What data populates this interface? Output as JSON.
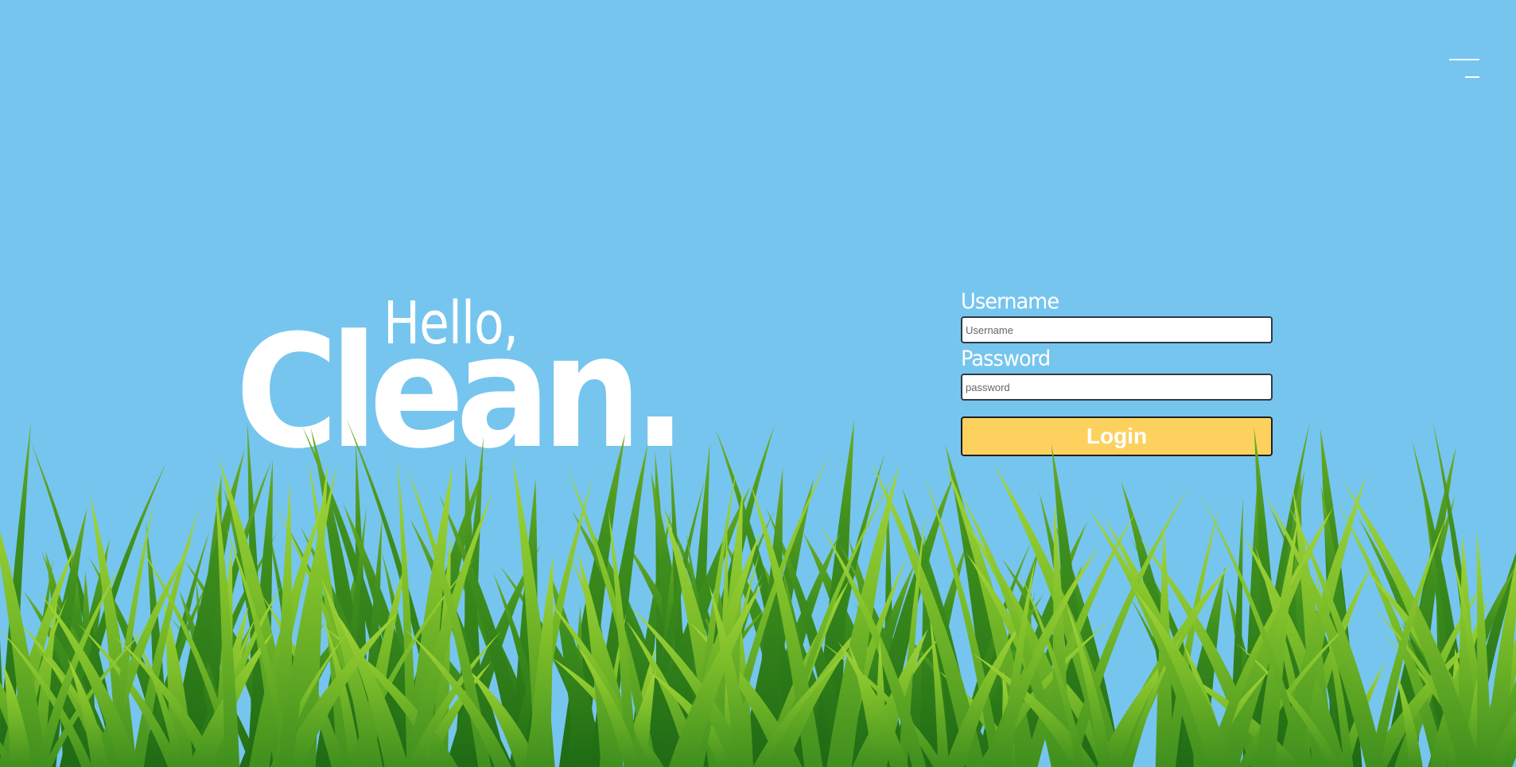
{
  "theme": {
    "sky_color": "#76c5ee",
    "accent_button": "#fdd15e",
    "grass_light": "#8dc63f",
    "grass_dark": "#2e7d1a"
  },
  "header": {
    "menu_icon": "hamburger-menu-icon"
  },
  "hero": {
    "greeting": "Hello,",
    "headline": "Clean."
  },
  "login": {
    "username_label": "Username",
    "username_placeholder": "Username",
    "username_value": "",
    "password_label": "Password",
    "password_placeholder": "password",
    "password_value": "",
    "submit_label": "Login"
  },
  "decoration": {
    "background_image": "grass-illustration"
  }
}
